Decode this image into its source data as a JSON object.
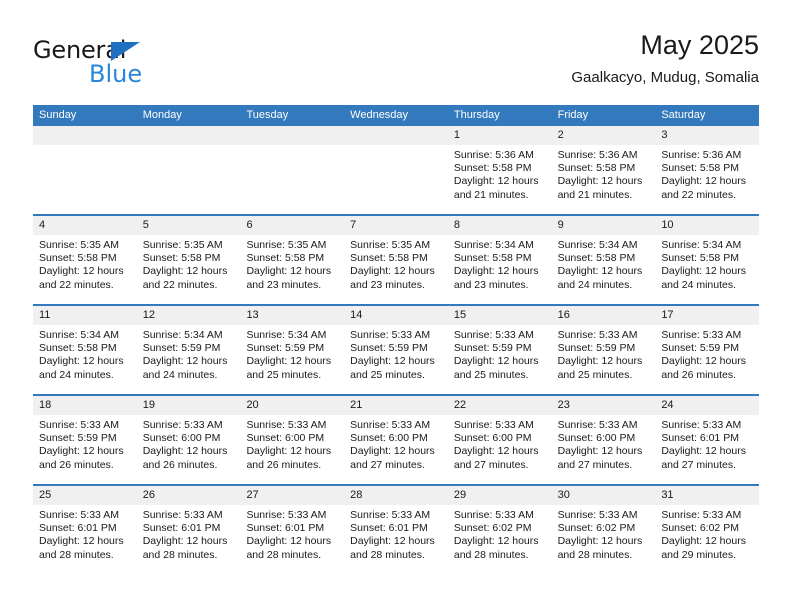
{
  "brand": {
    "name_top": "General",
    "name_bottom": "Blue",
    "accent_color": "#2a86d8",
    "triangle_color": "#1f70c1"
  },
  "header": {
    "title": "May 2025",
    "subtitle": "Gaalkacyo, Mudug, Somalia"
  },
  "calendar": {
    "header_color": "#3379bd",
    "weekday_headers": [
      "Sunday",
      "Monday",
      "Tuesday",
      "Wednesday",
      "Thursday",
      "Friday",
      "Saturday"
    ],
    "labels": {
      "sunrise": "Sunrise:",
      "sunset": "Sunset:",
      "daylight": "Daylight:"
    },
    "weeks": [
      [
        {
          "day": "",
          "empty": true
        },
        {
          "day": "",
          "empty": true
        },
        {
          "day": "",
          "empty": true
        },
        {
          "day": "",
          "empty": true
        },
        {
          "day": "1",
          "sunrise": "Sunrise: 5:36 AM",
          "sunset": "Sunset: 5:58 PM",
          "daylight_line1": "Daylight: 12 hours",
          "daylight_line2": "and 21 minutes."
        },
        {
          "day": "2",
          "sunrise": "Sunrise: 5:36 AM",
          "sunset": "Sunset: 5:58 PM",
          "daylight_line1": "Daylight: 12 hours",
          "daylight_line2": "and 21 minutes."
        },
        {
          "day": "3",
          "sunrise": "Sunrise: 5:36 AM",
          "sunset": "Sunset: 5:58 PM",
          "daylight_line1": "Daylight: 12 hours",
          "daylight_line2": "and 22 minutes."
        }
      ],
      [
        {
          "day": "4",
          "sunrise": "Sunrise: 5:35 AM",
          "sunset": "Sunset: 5:58 PM",
          "daylight_line1": "Daylight: 12 hours",
          "daylight_line2": "and 22 minutes."
        },
        {
          "day": "5",
          "sunrise": "Sunrise: 5:35 AM",
          "sunset": "Sunset: 5:58 PM",
          "daylight_line1": "Daylight: 12 hours",
          "daylight_line2": "and 22 minutes."
        },
        {
          "day": "6",
          "sunrise": "Sunrise: 5:35 AM",
          "sunset": "Sunset: 5:58 PM",
          "daylight_line1": "Daylight: 12 hours",
          "daylight_line2": "and 23 minutes."
        },
        {
          "day": "7",
          "sunrise": "Sunrise: 5:35 AM",
          "sunset": "Sunset: 5:58 PM",
          "daylight_line1": "Daylight: 12 hours",
          "daylight_line2": "and 23 minutes."
        },
        {
          "day": "8",
          "sunrise": "Sunrise: 5:34 AM",
          "sunset": "Sunset: 5:58 PM",
          "daylight_line1": "Daylight: 12 hours",
          "daylight_line2": "and 23 minutes."
        },
        {
          "day": "9",
          "sunrise": "Sunrise: 5:34 AM",
          "sunset": "Sunset: 5:58 PM",
          "daylight_line1": "Daylight: 12 hours",
          "daylight_line2": "and 24 minutes."
        },
        {
          "day": "10",
          "sunrise": "Sunrise: 5:34 AM",
          "sunset": "Sunset: 5:58 PM",
          "daylight_line1": "Daylight: 12 hours",
          "daylight_line2": "and 24 minutes."
        }
      ],
      [
        {
          "day": "11",
          "sunrise": "Sunrise: 5:34 AM",
          "sunset": "Sunset: 5:58 PM",
          "daylight_line1": "Daylight: 12 hours",
          "daylight_line2": "and 24 minutes."
        },
        {
          "day": "12",
          "sunrise": "Sunrise: 5:34 AM",
          "sunset": "Sunset: 5:59 PM",
          "daylight_line1": "Daylight: 12 hours",
          "daylight_line2": "and 24 minutes."
        },
        {
          "day": "13",
          "sunrise": "Sunrise: 5:34 AM",
          "sunset": "Sunset: 5:59 PM",
          "daylight_line1": "Daylight: 12 hours",
          "daylight_line2": "and 25 minutes."
        },
        {
          "day": "14",
          "sunrise": "Sunrise: 5:33 AM",
          "sunset": "Sunset: 5:59 PM",
          "daylight_line1": "Daylight: 12 hours",
          "daylight_line2": "and 25 minutes."
        },
        {
          "day": "15",
          "sunrise": "Sunrise: 5:33 AM",
          "sunset": "Sunset: 5:59 PM",
          "daylight_line1": "Daylight: 12 hours",
          "daylight_line2": "and 25 minutes."
        },
        {
          "day": "16",
          "sunrise": "Sunrise: 5:33 AM",
          "sunset": "Sunset: 5:59 PM",
          "daylight_line1": "Daylight: 12 hours",
          "daylight_line2": "and 25 minutes."
        },
        {
          "day": "17",
          "sunrise": "Sunrise: 5:33 AM",
          "sunset": "Sunset: 5:59 PM",
          "daylight_line1": "Daylight: 12 hours",
          "daylight_line2": "and 26 minutes."
        }
      ],
      [
        {
          "day": "18",
          "sunrise": "Sunrise: 5:33 AM",
          "sunset": "Sunset: 5:59 PM",
          "daylight_line1": "Daylight: 12 hours",
          "daylight_line2": "and 26 minutes."
        },
        {
          "day": "19",
          "sunrise": "Sunrise: 5:33 AM",
          "sunset": "Sunset: 6:00 PM",
          "daylight_line1": "Daylight: 12 hours",
          "daylight_line2": "and 26 minutes."
        },
        {
          "day": "20",
          "sunrise": "Sunrise: 5:33 AM",
          "sunset": "Sunset: 6:00 PM",
          "daylight_line1": "Daylight: 12 hours",
          "daylight_line2": "and 26 minutes."
        },
        {
          "day": "21",
          "sunrise": "Sunrise: 5:33 AM",
          "sunset": "Sunset: 6:00 PM",
          "daylight_line1": "Daylight: 12 hours",
          "daylight_line2": "and 27 minutes."
        },
        {
          "day": "22",
          "sunrise": "Sunrise: 5:33 AM",
          "sunset": "Sunset: 6:00 PM",
          "daylight_line1": "Daylight: 12 hours",
          "daylight_line2": "and 27 minutes."
        },
        {
          "day": "23",
          "sunrise": "Sunrise: 5:33 AM",
          "sunset": "Sunset: 6:00 PM",
          "daylight_line1": "Daylight: 12 hours",
          "daylight_line2": "and 27 minutes."
        },
        {
          "day": "24",
          "sunrise": "Sunrise: 5:33 AM",
          "sunset": "Sunset: 6:01 PM",
          "daylight_line1": "Daylight: 12 hours",
          "daylight_line2": "and 27 minutes."
        }
      ],
      [
        {
          "day": "25",
          "sunrise": "Sunrise: 5:33 AM",
          "sunset": "Sunset: 6:01 PM",
          "daylight_line1": "Daylight: 12 hours",
          "daylight_line2": "and 28 minutes."
        },
        {
          "day": "26",
          "sunrise": "Sunrise: 5:33 AM",
          "sunset": "Sunset: 6:01 PM",
          "daylight_line1": "Daylight: 12 hours",
          "daylight_line2": "and 28 minutes."
        },
        {
          "day": "27",
          "sunrise": "Sunrise: 5:33 AM",
          "sunset": "Sunset: 6:01 PM",
          "daylight_line1": "Daylight: 12 hours",
          "daylight_line2": "and 28 minutes."
        },
        {
          "day": "28",
          "sunrise": "Sunrise: 5:33 AM",
          "sunset": "Sunset: 6:01 PM",
          "daylight_line1": "Daylight: 12 hours",
          "daylight_line2": "and 28 minutes."
        },
        {
          "day": "29",
          "sunrise": "Sunrise: 5:33 AM",
          "sunset": "Sunset: 6:02 PM",
          "daylight_line1": "Daylight: 12 hours",
          "daylight_line2": "and 28 minutes."
        },
        {
          "day": "30",
          "sunrise": "Sunrise: 5:33 AM",
          "sunset": "Sunset: 6:02 PM",
          "daylight_line1": "Daylight: 12 hours",
          "daylight_line2": "and 28 minutes."
        },
        {
          "day": "31",
          "sunrise": "Sunrise: 5:33 AM",
          "sunset": "Sunset: 6:02 PM",
          "daylight_line1": "Daylight: 12 hours",
          "daylight_line2": "and 29 minutes."
        }
      ]
    ]
  }
}
